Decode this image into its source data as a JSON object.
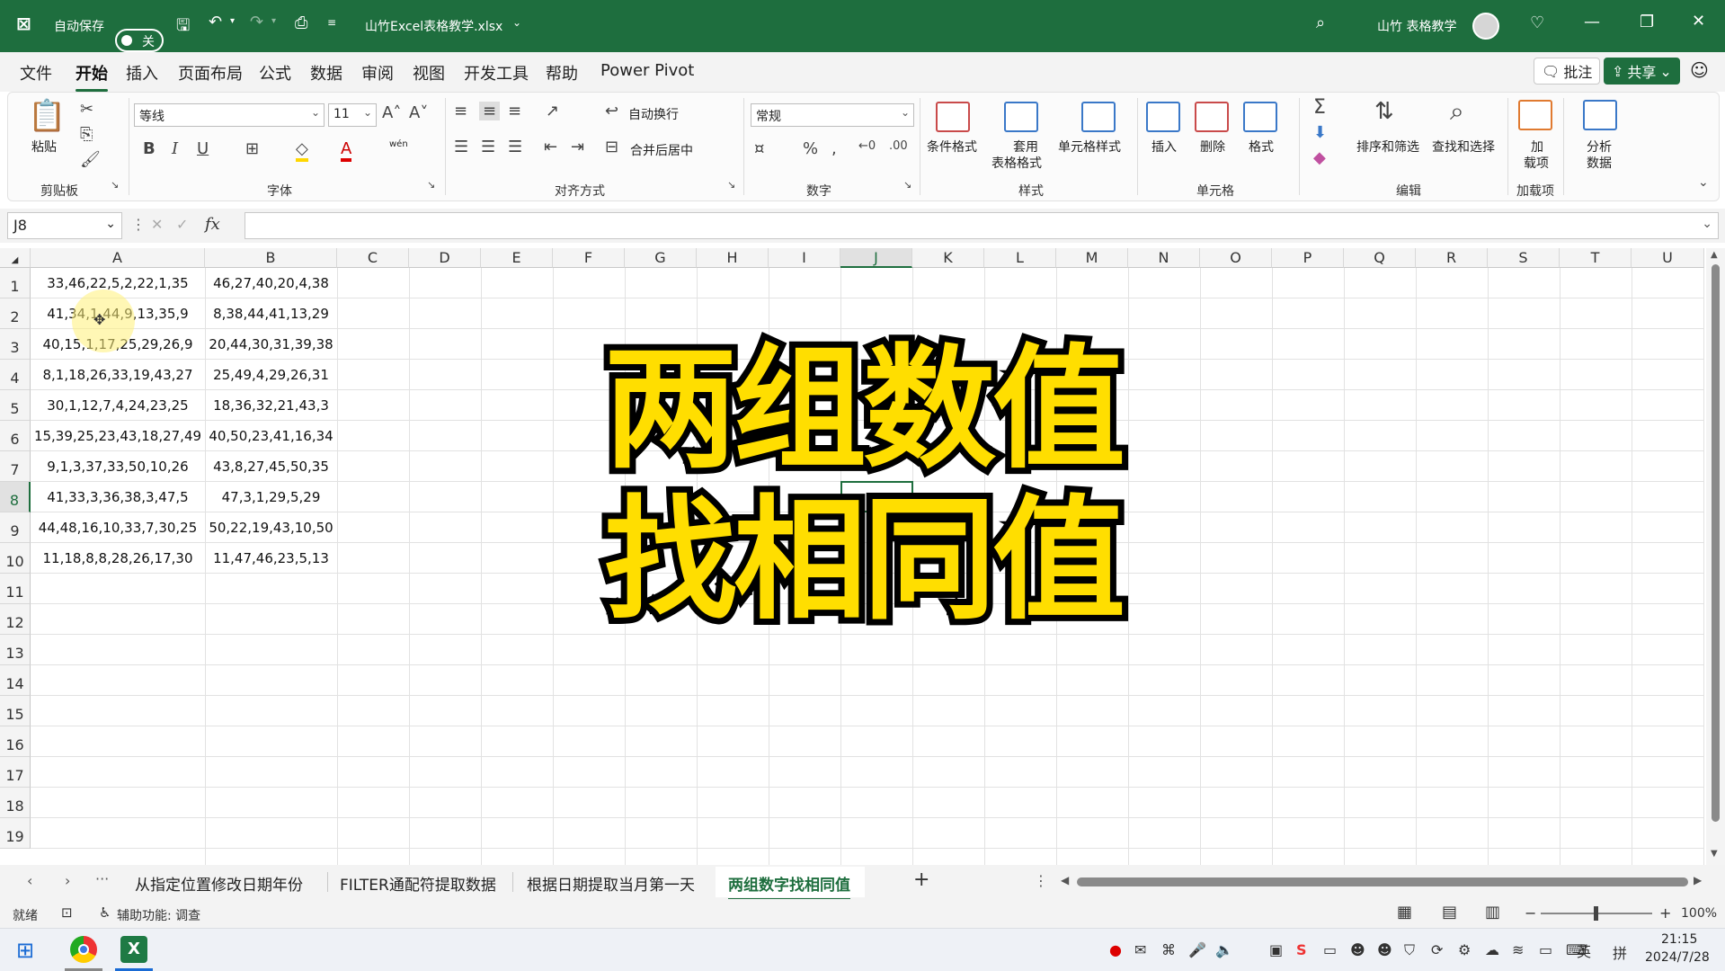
{
  "titlebar": {
    "autosave_label": "自动保存",
    "autosave_state": "关",
    "filename": "山竹Excel表格教学.xlsx",
    "user_name": "山竹 表格教学"
  },
  "menu": {
    "tabs": [
      "文件",
      "开始",
      "插入",
      "页面布局",
      "公式",
      "数据",
      "审阅",
      "视图",
      "开发工具",
      "帮助",
      "Power Pivot"
    ],
    "active_tab": "开始",
    "comment_label": "批注",
    "share_label": "共享"
  },
  "ribbon": {
    "clipboard": {
      "paste": "粘贴",
      "group": "剪贴板"
    },
    "font": {
      "family": "等线",
      "size": "11",
      "group": "字体",
      "phonetic": "wén"
    },
    "alignment": {
      "wrap": "自动换行",
      "merge": "合并后居中",
      "group": "对齐方式"
    },
    "number": {
      "format": "常规",
      "group": "数字"
    },
    "styles": {
      "conditional": "条件格式",
      "table_fmt_1": "套用",
      "table_fmt_2": "表格格式",
      "cell_styles": "单元格样式",
      "group": "样式"
    },
    "cells": {
      "insert": "插入",
      "delete": "删除",
      "format": "格式",
      "group": "单元格"
    },
    "editing": {
      "sort": "排序和筛选",
      "find": "查找和选择",
      "group": "编辑"
    },
    "addins": {
      "label_1": "加",
      "label_2": "载项",
      "group": "加载项"
    },
    "analyze": {
      "label_1": "分析",
      "label_2": "数据"
    }
  },
  "formula_bar": {
    "cell_ref": "J8",
    "fx": "fx",
    "content": ""
  },
  "grid": {
    "columns": [
      "A",
      "B",
      "C",
      "D",
      "E",
      "F",
      "G",
      "H",
      "I",
      "J",
      "K",
      "L",
      "M",
      "N",
      "O",
      "P",
      "Q",
      "R",
      "S",
      "T",
      "U"
    ],
    "selected_column": "J",
    "rows": [
      "1",
      "2",
      "3",
      "4",
      "5",
      "6",
      "7",
      "8",
      "9",
      "10",
      "11",
      "12",
      "13",
      "14",
      "15",
      "16",
      "17",
      "18",
      "19"
    ],
    "selected_row": "8",
    "col_a": [
      "33,46,22,5,2,22,1,35",
      "41,34,1,44,9,13,35,9",
      "40,15,1,17,25,29,26,9",
      "8,1,18,26,33,19,43,27",
      "30,1,12,7,4,24,23,25",
      "15,39,25,23,43,18,27,49",
      "9,1,3,37,33,50,10,26",
      "41,33,3,36,38,3,47,5",
      "44,48,16,10,33,7,30,25",
      "11,18,8,8,28,26,17,30"
    ],
    "col_b": [
      "46,27,40,20,4,38",
      "8,38,44,41,13,29",
      "20,44,30,31,39,38",
      "25,49,4,29,26,31",
      "18,36,32,21,43,3",
      "40,50,23,41,16,34",
      "43,8,27,45,50,35",
      "47,3,1,29,5,29",
      "50,22,19,43,10,50",
      "11,47,46,23,5,13"
    ]
  },
  "overlay": {
    "line1": "两组数值",
    "line2": "找相同值",
    "fill_color": "#ffde00",
    "stroke_color": "#000000"
  },
  "sheets": {
    "tabs": [
      "从指定位置修改日期年份",
      "FILTER通配符提取数据",
      "根据日期提取当月第一天",
      "两组数字找相同值"
    ],
    "active": "两组数字找相同值",
    "add": "+"
  },
  "status": {
    "ready": "就绪",
    "accessibility": "辅助功能: 调查",
    "zoom": "100%"
  },
  "taskbar": {
    "ime": "英",
    "time": "21:15",
    "date": "2024/7/28"
  },
  "colors": {
    "brand": "#1e6e3e"
  }
}
